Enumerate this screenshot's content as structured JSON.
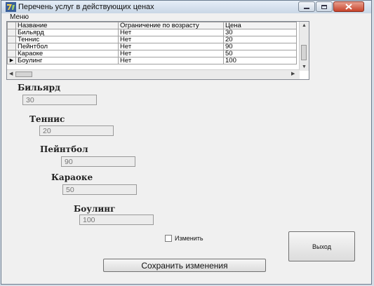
{
  "window": {
    "title": "Перечень услуг в действующих ценах"
  },
  "menu": {
    "label": "Меню"
  },
  "table": {
    "columns": [
      "Название",
      "Ограничение по возрасту",
      "Цена"
    ],
    "rows": [
      [
        "Бильярд",
        "Нет",
        "30"
      ],
      [
        "Теннис",
        "Нет",
        "20"
      ],
      [
        "Пейнтбол",
        "Нет",
        "90"
      ],
      [
        "Караоке",
        "Нет",
        "50"
      ],
      [
        "Боулинг",
        "Нет",
        "100"
      ]
    ],
    "current_row_marker": "▶"
  },
  "services": {
    "billiard": {
      "label": "Бильярд",
      "price": "30"
    },
    "tennis": {
      "label": "Теннис",
      "price": "20"
    },
    "paintball": {
      "label": "Пейнтбол",
      "price": "90"
    },
    "karaoke": {
      "label": "Караоке",
      "price": "50"
    },
    "bowling": {
      "label": "Боулинг",
      "price": "100"
    }
  },
  "edit_checkbox": {
    "label": "Изменить",
    "checked": false
  },
  "buttons": {
    "exit": "Выход",
    "save": "Сохранить изменения"
  }
}
